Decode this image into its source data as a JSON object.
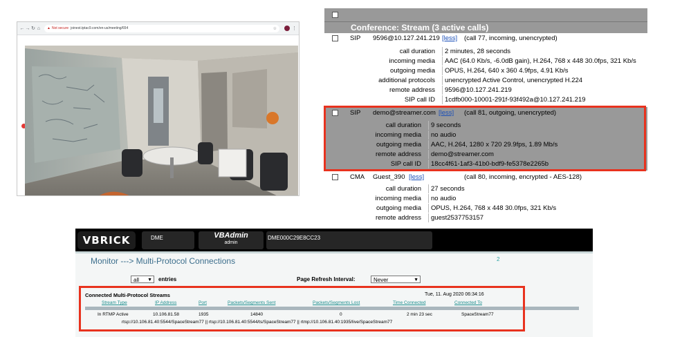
{
  "browser": {
    "url": "joinest.tptac9.com/en-us/meeting/654",
    "security_label": "Not secure"
  },
  "conference": {
    "title": "Conference: Stream (3 active calls)",
    "calls": [
      {
        "protocol": "SIP",
        "address": "9596@10.127.241.219",
        "less_label": "[less]",
        "summary": "(call 77, incoming, unencrypted)",
        "details": [
          {
            "label": "call duration",
            "value": "2 minutes, 28 seconds"
          },
          {
            "label": "incoming media",
            "value": "AAC (64.0 Kb/s, -6.0dB gain), H.264, 768 x 448 30.0fps, 321 Kb/s"
          },
          {
            "label": "outgoing media",
            "value": "OPUS, H.264, 640 x 360 4.9fps, 4.91 Kb/s"
          },
          {
            "label": "additional protocols",
            "value": "unencrypted Active Control, unencrypted H.224"
          },
          {
            "label": "remote address",
            "value": "9596@10.127.241.219"
          },
          {
            "label": "SIP call ID",
            "value": "1cdfb000-10001-291f-93f492a@10.127.241.219"
          }
        ]
      },
      {
        "protocol": "SIP",
        "address": "demo@streamer.com",
        "less_label": "[less]",
        "summary": "(call 81, outgoing, unencrypted)",
        "details": [
          {
            "label": "call duration",
            "value": "9 seconds"
          },
          {
            "label": "incoming media",
            "value": "no audio"
          },
          {
            "label": "outgoing media",
            "value": "AAC, H.264, 1280 x 720 29.9fps, 1.89 Mb/s"
          },
          {
            "label": "remote address",
            "value": "demo@streamer.com"
          },
          {
            "label": "SIP call ID",
            "value": "18cc4f61-1af3-41b0-bdf9-fe5378e2265b"
          }
        ]
      },
      {
        "protocol": "CMA",
        "address": "Guest_390",
        "less_label": "[less]",
        "summary": "(call 80, incoming, encrypted - AES-128)",
        "details": [
          {
            "label": "call duration",
            "value": "27 seconds"
          },
          {
            "label": "incoming media",
            "value": "no audio"
          },
          {
            "label": "outgoing media",
            "value": "OPUS, H.264, 768 x 448 30.0fps, 321 Kb/s"
          },
          {
            "label": "remote address",
            "value": "guest2537753157"
          }
        ]
      }
    ]
  },
  "vbrick": {
    "logo": "VBRICK",
    "dme_label": "DME",
    "app_title": "VBAdmin",
    "app_subtitle": "admin",
    "device_name": "DME000C29E8CC23",
    "breadcrumb": "Monitor ---> Multi-Protocol Connections",
    "help_number": "2",
    "entries_select": "all",
    "entries_label": "entries",
    "refresh_label": "Page Refresh Interval:",
    "refresh_select": "Never",
    "table_title": "Connected Multi-Protocol Streams",
    "timestamp": "Tue, 11. Aug 2020 06:34:16",
    "columns": [
      "Stream Type",
      "IP Address",
      "Port",
      "Packets/Segments Sent",
      "Packets/Segments Lost",
      "Time Connected",
      "Connected To"
    ],
    "row": [
      "In RTMP Active",
      "10.106.81.58",
      "1935",
      "14840",
      "0",
      "2 min 23 sec",
      "SpaceStream77"
    ],
    "urls": "rtsp://10.106.81.40:5544/SpaceStream77  ||  rtsp://10.106.81.40:5544/ts/SpaceStream77  ||  rtmp://10.106.81.40:1935/live/SpaceStream77"
  }
}
